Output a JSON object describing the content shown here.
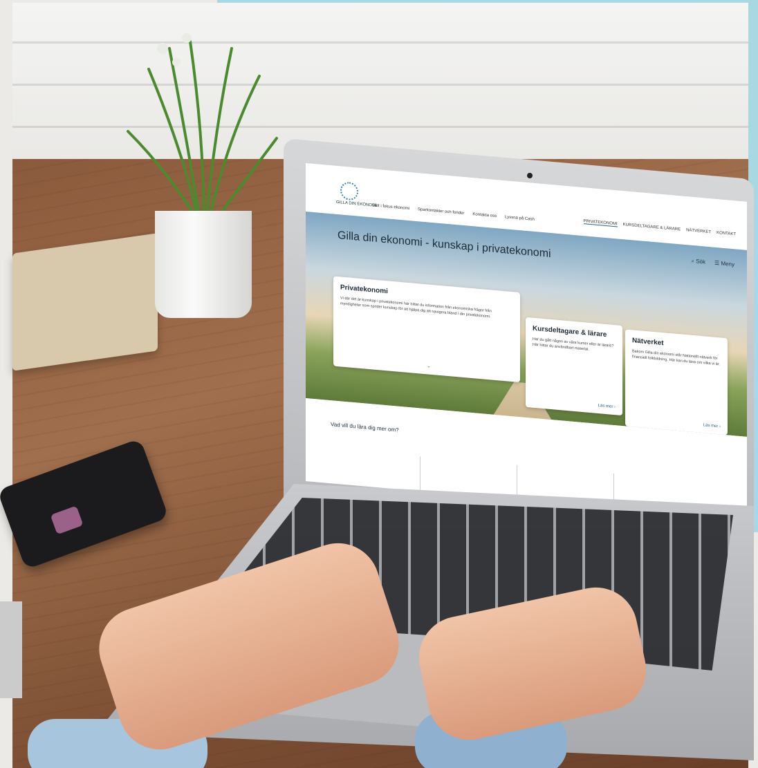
{
  "site": {
    "logo_text": "GILLA DIN EKONOMI",
    "nav": [
      "Sätt i fokus ekonomi",
      "Sparkontakter och fonder",
      "Kontakta oss",
      "Lyssna på Cash"
    ],
    "topnav": [
      "PRIVATEKONOMI",
      "KURSDELTAGARE & LÄRARE",
      "NÄTVERKET",
      "KONTAKT"
    ],
    "search_label": "Sök",
    "menu_label": "Meny",
    "hero_title": "Gilla din ekonomi - kunskap i privatekonomi",
    "cards": [
      {
        "title": "Privatekonomi",
        "text": "Vi där det är kunskap i privatekonomi här hittar du information från ekonomiska frågor från myndigheter som sprider kunskap för att hjälpa dig att navigera bland i din privatekonomi.",
        "more": ""
      },
      {
        "title": "Kursdeltagare & lärare",
        "text": "Har du gått någon av våra kurser eller är lärare? Här hittar du användbart material.",
        "more": "Läs mer ›"
      },
      {
        "title": "Nätverket",
        "text": "Bakom Gilla din ekonomi står Nationellt nätverk för finansiell folkbildning. Här kan du läsa om vilka vi är.",
        "more": "Läs mer ›"
      }
    ],
    "lower_heading": "Vad vill du lära dig mer om?"
  },
  "colors": {
    "accent_frame": "#a8d9e2",
    "desk": "#8a5a3c",
    "link": "#2a5f86"
  }
}
